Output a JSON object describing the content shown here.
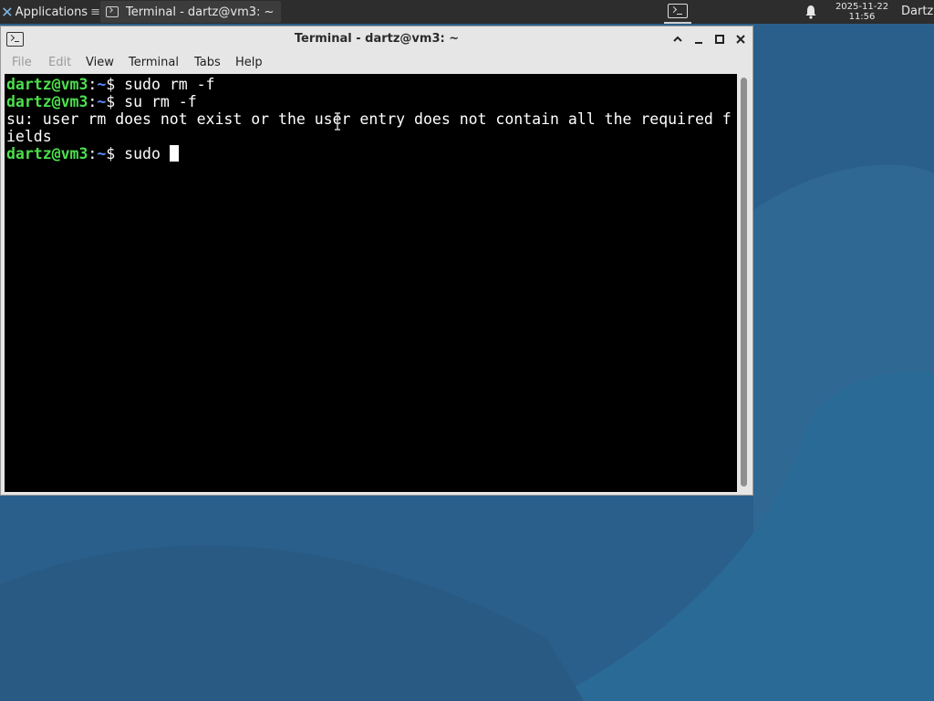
{
  "panel": {
    "applications_label": "Applications",
    "taskbar_label": "Terminal - dartz@vm3: ~",
    "clock_date": "2025-11-22",
    "clock_time": "11:56",
    "user": "Dartz"
  },
  "window": {
    "title": "Terminal - dartz@vm3: ~",
    "menu": [
      "File",
      "Edit",
      "View",
      "Terminal",
      "Tabs",
      "Help"
    ]
  },
  "terminal": {
    "prompt_user": "dartz@vm3",
    "prompt_sep": ":",
    "prompt_path": "~",
    "prompt_symbol": "$",
    "lines": [
      {
        "cmd": " sudo rm -f"
      },
      {
        "cmd": " su rm -f"
      },
      {
        "output": "su: user rm does not exist or the user entry does not contain all the required f"
      },
      {
        "output": "ields"
      },
      {
        "cmd": " sudo "
      }
    ]
  },
  "colors": {
    "desktop": "#2a5f8b",
    "panel": "#2d2d2d",
    "prompt_user": "#4ce04c",
    "prompt_path": "#5c8dff"
  }
}
